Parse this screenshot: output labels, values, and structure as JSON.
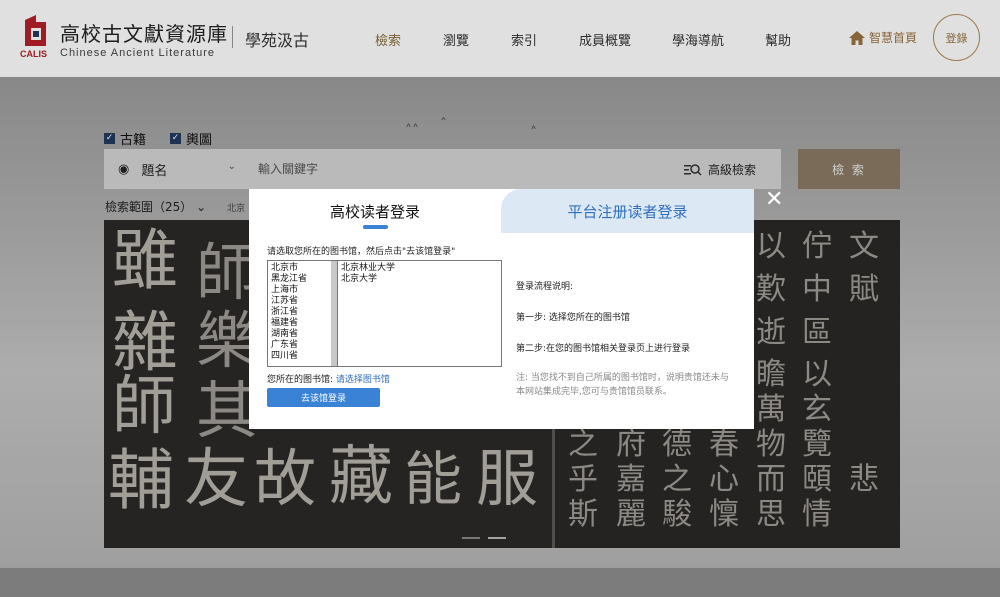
{
  "header": {
    "title": "高校古文獻資源庫",
    "subtitle": "Chinese Ancient Literature",
    "logo_text": "CALIS",
    "slogan": "學苑汲古",
    "nav": [
      "檢索",
      "瀏覽",
      "索引",
      "成員概覽",
      "學海導航",
      "幫助"
    ],
    "home_link": "智慧首頁",
    "login": "登錄"
  },
  "search": {
    "checkboxes": [
      "古籍",
      "輿圖"
    ],
    "field_select": "題名",
    "placeholder": "輸入關鍵字",
    "advanced": "高級檢索",
    "button": "檢 索",
    "scope": "檢索範圍（25）",
    "scope_extra": "北京"
  },
  "banner": {
    "left_chars": [
      "雖",
      "師",
      "雜",
      "樂",
      "師",
      "其",
      "輔",
      "友",
      "故",
      "藏",
      "能",
      "服"
    ],
    "right_chars": [
      "文",
      "佇",
      "以",
      "賦",
      "中",
      "歎",
      "區",
      "逝",
      "以",
      "瞻",
      "玄",
      "萬",
      "覽",
      "物",
      "頤",
      "之",
      "府",
      "德",
      "春",
      "情",
      "而",
      "心",
      "之",
      "乎",
      "嘉",
      "思",
      "悲",
      "懍",
      "駿",
      "斯",
      "麗"
    ]
  },
  "modal": {
    "tab_left": "高校读者登录",
    "tab_right": "平台注册读者登录",
    "close": "✕",
    "instruction": "请选取您所在的图书馆，然后点击\"去该馆登录\"",
    "provinces": [
      "北京市",
      "黑龙江省",
      "上海市",
      "江苏省",
      "浙江省",
      "福建省",
      "湖南省",
      "广东省",
      "四川省"
    ],
    "libraries": [
      "北京林业大学",
      "北京大学"
    ],
    "library_label": "您所在的图书馆:",
    "library_link": "请选择图书馆",
    "go_button": "去该馆登录",
    "process_title": "登录流程说明:",
    "step1": "第一步: 选择您所在的图书馆",
    "step2": "第二步:在您的图书馆相关登录页上进行登录",
    "note": "注: 当您找不到自己所属的图书馆时，说明贵馆还未与本网站集成完毕,您可与贵馆馆员联系。"
  }
}
